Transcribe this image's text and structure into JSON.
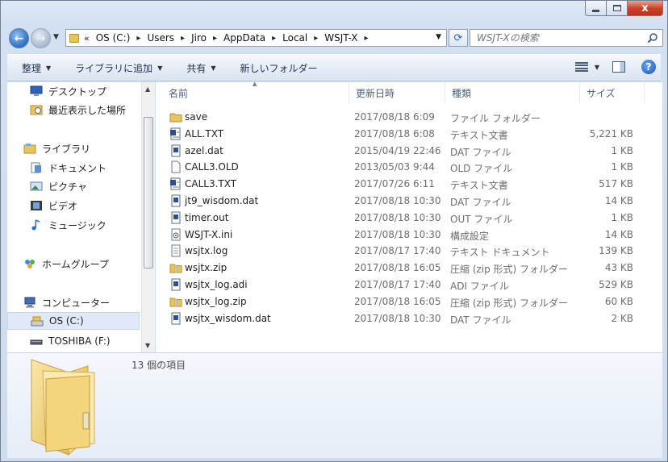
{
  "window": {
    "close_label": "x"
  },
  "nav": {
    "back_label": "←",
    "forward_label": "→"
  },
  "address": {
    "overflow": "«",
    "crumbs": [
      "OS (C:)",
      "Users",
      "Jiro",
      "AppData",
      "Local",
      "WSJT-X"
    ]
  },
  "search": {
    "placeholder": "WSJT-Xの検索"
  },
  "toolbar": {
    "organize": "整理",
    "add_to_library": "ライブラリに追加",
    "share": "共有",
    "new_folder": "新しいフォルダー",
    "help_label": "?"
  },
  "sidebar": {
    "items": [
      {
        "label": "デスクトップ",
        "icon": "desktop-icon"
      },
      {
        "label": "最近表示した場所",
        "icon": "recent-places-icon"
      },
      {
        "label": "ライブラリ",
        "icon": "libraries-icon"
      },
      {
        "label": "ドキュメント",
        "icon": "documents-icon"
      },
      {
        "label": "ピクチャ",
        "icon": "pictures-icon"
      },
      {
        "label": "ビデオ",
        "icon": "videos-icon"
      },
      {
        "label": "ミュージック",
        "icon": "music-icon"
      },
      {
        "label": "ホームグループ",
        "icon": "homegroup-icon"
      },
      {
        "label": "コンピューター",
        "icon": "computer-icon"
      },
      {
        "label": "OS (C:)",
        "icon": "drive-c-icon"
      },
      {
        "label": "TOSHIBA (F:)",
        "icon": "usb-drive-icon"
      }
    ]
  },
  "columns": {
    "name": "名前",
    "date": "更新日時",
    "type": "種類",
    "size": "サイズ"
  },
  "files": [
    {
      "name": "save",
      "date": "2017/08/18 6:09",
      "type": "ファイル フォルダー",
      "size": "",
      "icon": "folder-icon"
    },
    {
      "name": "ALL.TXT",
      "date": "2017/08/18 6:08",
      "type": "テキスト文書",
      "size": "5,221 KB",
      "icon": "text-file-icon"
    },
    {
      "name": "azel.dat",
      "date": "2015/04/19 22:46",
      "type": "DAT ファイル",
      "size": "1 KB",
      "icon": "dat-file-icon"
    },
    {
      "name": "CALL3.OLD",
      "date": "2013/05/03 9:44",
      "type": "OLD ファイル",
      "size": "1 KB",
      "icon": "blank-file-icon"
    },
    {
      "name": "CALL3.TXT",
      "date": "2017/07/26 6:11",
      "type": "テキスト文書",
      "size": "517 KB",
      "icon": "text-file-icon"
    },
    {
      "name": "jt9_wisdom.dat",
      "date": "2017/08/18 10:30",
      "type": "DAT ファイル",
      "size": "14 KB",
      "icon": "dat-file-icon"
    },
    {
      "name": "timer.out",
      "date": "2017/08/18 10:30",
      "type": "OUT ファイル",
      "size": "1 KB",
      "icon": "dat-file-icon"
    },
    {
      "name": "WSJT-X.ini",
      "date": "2017/08/18 10:30",
      "type": "構成設定",
      "size": "14 KB",
      "icon": "ini-file-icon"
    },
    {
      "name": "wsjtx.log",
      "date": "2017/08/17 17:40",
      "type": "テキスト ドキュメント",
      "size": "139 KB",
      "icon": "log-file-icon"
    },
    {
      "name": "wsjtx.zip",
      "date": "2017/08/18 16:05",
      "type": "圧縮 (zip 形式) フォルダー",
      "size": "43 KB",
      "icon": "zip-folder-icon"
    },
    {
      "name": "wsjtx_log.adi",
      "date": "2017/08/17 17:40",
      "type": "ADI ファイル",
      "size": "529 KB",
      "icon": "dat-file-icon"
    },
    {
      "name": "wsjtx_log.zip",
      "date": "2017/08/18 16:05",
      "type": "圧縮 (zip 形式) フォルダー",
      "size": "60 KB",
      "icon": "zip-folder-icon"
    },
    {
      "name": "wsjtx_wisdom.dat",
      "date": "2017/08/18 10:30",
      "type": "DAT ファイル",
      "size": "2 KB",
      "icon": "dat-file-icon"
    }
  ],
  "details": {
    "item_count": "13 個の項目"
  }
}
